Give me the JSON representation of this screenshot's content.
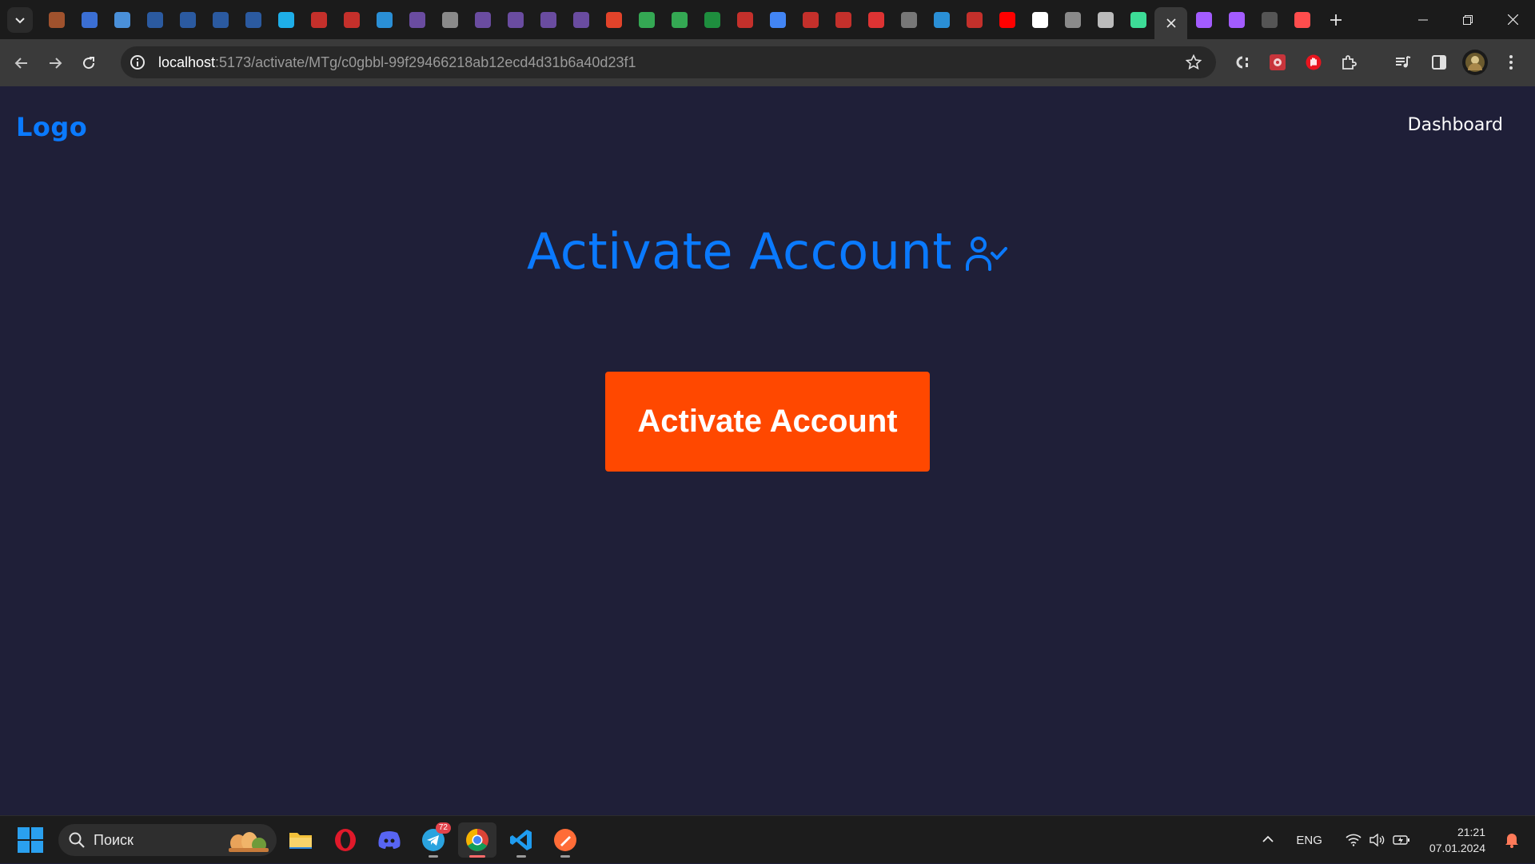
{
  "browser": {
    "tabs": [
      {
        "icon": "user-app-icon",
        "color": "#a0522d"
      },
      {
        "icon": "trello-icon",
        "color": "#3b6fd4"
      },
      {
        "icon": "chat-icon",
        "color": "#4a90d9"
      },
      {
        "icon": "vk-icon",
        "color": "#2b5aa0"
      },
      {
        "icon": "vk-icon",
        "color": "#2b5aa0"
      },
      {
        "icon": "vk-icon",
        "color": "#2b5aa0"
      },
      {
        "icon": "vk-icon",
        "color": "#2b5aa0"
      },
      {
        "icon": "heart-app-icon",
        "color": "#1eaee8"
      },
      {
        "icon": "youtube-icon",
        "color": "#c4302b"
      },
      {
        "icon": "youtube-icon",
        "color": "#c4302b"
      },
      {
        "icon": "swift-icon",
        "color": "#2a8fd6"
      },
      {
        "icon": "knot-icon",
        "color": "#6a4ca0"
      },
      {
        "icon": "globe-icon",
        "color": "#8a8a8a"
      },
      {
        "icon": "knot-icon",
        "color": "#6a4ca0"
      },
      {
        "icon": "knot-icon",
        "color": "#6a4ca0"
      },
      {
        "icon": "knot-icon",
        "color": "#6a4ca0"
      },
      {
        "icon": "knot-icon",
        "color": "#6a4ca0"
      },
      {
        "icon": "gitlab-icon",
        "color": "#e2432a"
      },
      {
        "icon": "drive-icon",
        "color": "#34a853"
      },
      {
        "icon": "drive-icon",
        "color": "#34a853"
      },
      {
        "icon": "sheets-icon",
        "color": "#1e8e3e"
      },
      {
        "icon": "youtube-icon",
        "color": "#c4302b"
      },
      {
        "icon": "docs-icon",
        "color": "#4285f4"
      },
      {
        "icon": "youtube-icon",
        "color": "#c4302b"
      },
      {
        "icon": "youtube-icon",
        "color": "#c4302b"
      },
      {
        "icon": "letter-a-icon",
        "color": "#d33"
      },
      {
        "icon": "cat-icon",
        "color": "#777"
      },
      {
        "icon": "swift-icon",
        "color": "#2a8fd6"
      },
      {
        "icon": "youtube-icon",
        "color": "#c4302b"
      },
      {
        "icon": "youtube-icon",
        "color": "#ff0000"
      },
      {
        "icon": "github-icon",
        "color": "#ffffff"
      },
      {
        "icon": "globe-icon",
        "color": "#8a8a8a"
      },
      {
        "icon": "globe-icon",
        "color": "#bbbbbb"
      },
      {
        "icon": "m-logo-icon",
        "color": "#3ddc97"
      }
    ],
    "tabs_after_active": [
      {
        "icon": "vite-icon",
        "color": "#a35cff"
      },
      {
        "icon": "vite-icon",
        "color": "#a35cff"
      },
      {
        "icon": "github-icon",
        "color": "#555555"
      },
      {
        "icon": "letter-a-icon",
        "color": "#ff4d4d"
      }
    ],
    "url_host": "localhost",
    "url_path": ":5173/activate/MTg/c0gbbl-99f29466218ab12ecd4d31b6a40d23f1"
  },
  "page": {
    "logo": "Logo",
    "nav_dashboard": "Dashboard",
    "title": "Activate Account",
    "button_label": "Activate Account",
    "accent_color": "#0a7aff",
    "button_color": "#ff4800"
  },
  "taskbar": {
    "search_placeholder": "Поиск",
    "telegram_badge": "72",
    "lang": "ENG",
    "time": "21:21",
    "date": "07.01.2024"
  }
}
